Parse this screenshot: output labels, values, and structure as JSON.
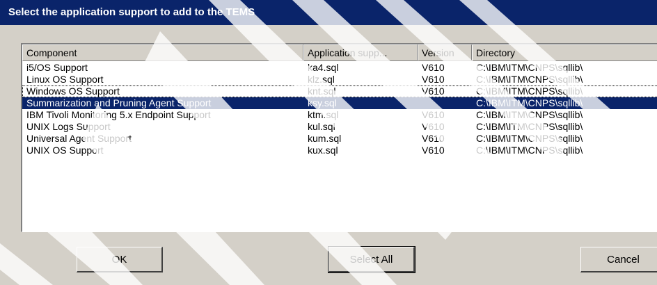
{
  "dialog": {
    "title": "Select the application support to add to the TEMS"
  },
  "list": {
    "columns": [
      {
        "label": "Component"
      },
      {
        "label": "Application supp..."
      },
      {
        "label": "Version"
      },
      {
        "label": "Directory"
      }
    ],
    "rows": [
      {
        "component": "i5/OS Support",
        "app": "ka4.sql",
        "version": "V610",
        "directory": "C:\\IBM\\ITM\\CNPS\\sqllib\\",
        "selected": false
      },
      {
        "component": "Linux OS Support",
        "app": "klz.sql",
        "version": "V610",
        "directory": "C:\\IBM\\ITM\\CNPS\\sqllib\\",
        "selected": false
      },
      {
        "component": "Windows OS Support",
        "app": "knt.sql",
        "version": "V610",
        "directory": "C:\\IBM\\ITM\\CNPS\\sqllib\\",
        "selected": false,
        "focused": true
      },
      {
        "component": "Summarization and Pruning Agent Support",
        "app": "ksy.sql",
        "version": "",
        "directory": "C:\\IBM\\ITM\\CNPS\\sqllib\\",
        "selected": true
      },
      {
        "component": "IBM Tivoli Monitoring 5.x Endpoint Support",
        "app": "ktm.sql",
        "version": "V610",
        "directory": "C:\\IBM\\ITM\\CNPS\\sqllib\\",
        "selected": false
      },
      {
        "component": "UNIX Logs Support",
        "app": "kul.sql",
        "version": "V610",
        "directory": "C:\\IBM\\ITM\\CNPS\\sqllib\\",
        "selected": false
      },
      {
        "component": "Universal Agent Support",
        "app": "kum.sql",
        "version": "V610",
        "directory": "C:\\IBM\\ITM\\CNPS\\sqllib\\",
        "selected": false
      },
      {
        "component": "UNIX OS Support",
        "app": "kux.sql",
        "version": "V610",
        "directory": "C:\\IBM\\ITM\\CNPS\\sqllib\\",
        "selected": false
      }
    ]
  },
  "buttons": {
    "ok": "OK",
    "select_all": "Select All",
    "cancel": "Cancel"
  },
  "colors": {
    "titlebar": "#0a246a",
    "selection": "#0a246a",
    "face": "#d4d0c8"
  }
}
